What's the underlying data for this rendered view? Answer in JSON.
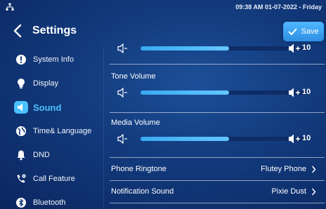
{
  "status_bar": {
    "datetime": "09:38 AM  01-07-2022 - Friday"
  },
  "header": {
    "title": "Settings",
    "save_label": "Save"
  },
  "sidebar": {
    "items": [
      {
        "label": "System Info",
        "icon": "info-icon"
      },
      {
        "label": "Display",
        "icon": "bulb-icon"
      },
      {
        "label": "Sound",
        "icon": "speaker-icon",
        "active": true
      },
      {
        "label": "Time& Language",
        "icon": "globe-icon"
      },
      {
        "label": "DND",
        "icon": "bell-icon"
      },
      {
        "label": "Call Feature",
        "icon": "phone-gear-icon"
      },
      {
        "label": "Bluetooth",
        "icon": "bluetooth-icon"
      }
    ]
  },
  "main": {
    "partial_volume": {
      "value": "10",
      "level": 0.53
    },
    "tone_volume": {
      "title": "Tone Volume",
      "value": "10",
      "level": 0.53
    },
    "media_volume": {
      "title": "Media Volume",
      "value": "10",
      "level": 0.53
    },
    "phone_ringtone": {
      "label": "Phone Ringtone",
      "value": "Flutey Phone"
    },
    "notification_sound": {
      "label": "Notification Sound",
      "value": "Pixie Dust"
    }
  },
  "colors": {
    "accent": "#4cc0ff",
    "save_button": "#3aa3f0",
    "background": "#123a7c"
  }
}
